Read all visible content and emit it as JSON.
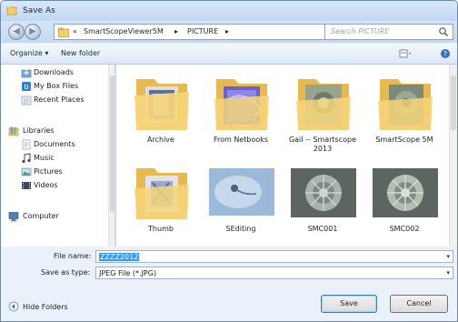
{
  "window": {
    "title": "Save As"
  },
  "address": {
    "crumbs": [
      "«",
      "SmartScopeViewer5M",
      "▸",
      "PICTURE",
      "▸"
    ],
    "search_placeholder": "Search PICTURE"
  },
  "toolbar": {
    "organize": "Organize ▾",
    "new_folder": "New folder"
  },
  "nav": {
    "items": [
      {
        "label": "Downloads",
        "icon": "downloads-icon"
      },
      {
        "label": "My Box Files",
        "icon": "box-files-icon"
      },
      {
        "label": "Recent Places",
        "icon": "recent-places-icon"
      },
      {
        "label": "Libraries",
        "icon": "libraries-icon"
      },
      {
        "label": "Documents",
        "icon": "documents-icon"
      },
      {
        "label": "Music",
        "icon": "music-icon"
      },
      {
        "label": "Pictures",
        "icon": "pictures-icon"
      },
      {
        "label": "Videos",
        "icon": "videos-icon"
      },
      {
        "label": "Computer",
        "icon": "computer-icon"
      }
    ]
  },
  "files": [
    {
      "name": "Archive",
      "kind": "folder"
    },
    {
      "name": "From Netbooks",
      "kind": "folder"
    },
    {
      "name": "Gail -- Smartscope 2013",
      "kind": "folder"
    },
    {
      "name": "SmartScope 5M",
      "kind": "folder"
    },
    {
      "name": "Thumb",
      "kind": "folder"
    },
    {
      "name": "SEditing",
      "kind": "image"
    },
    {
      "name": "SMC001",
      "kind": "image"
    },
    {
      "name": "SMC002",
      "kind": "image"
    }
  ],
  "form": {
    "file_name_label": "File name:",
    "file_name_value": "ZZZZ2012",
    "save_type_label": "Save as type:",
    "save_type_value": "JPEG File (*.JPG)",
    "save_button": "Save",
    "cancel_button": "Cancel",
    "hide_folders": "Hide Folders"
  },
  "colors": {
    "window_frame": "#bfd5ee",
    "selection": "#3399ff",
    "folder": "#f2cf6b"
  }
}
